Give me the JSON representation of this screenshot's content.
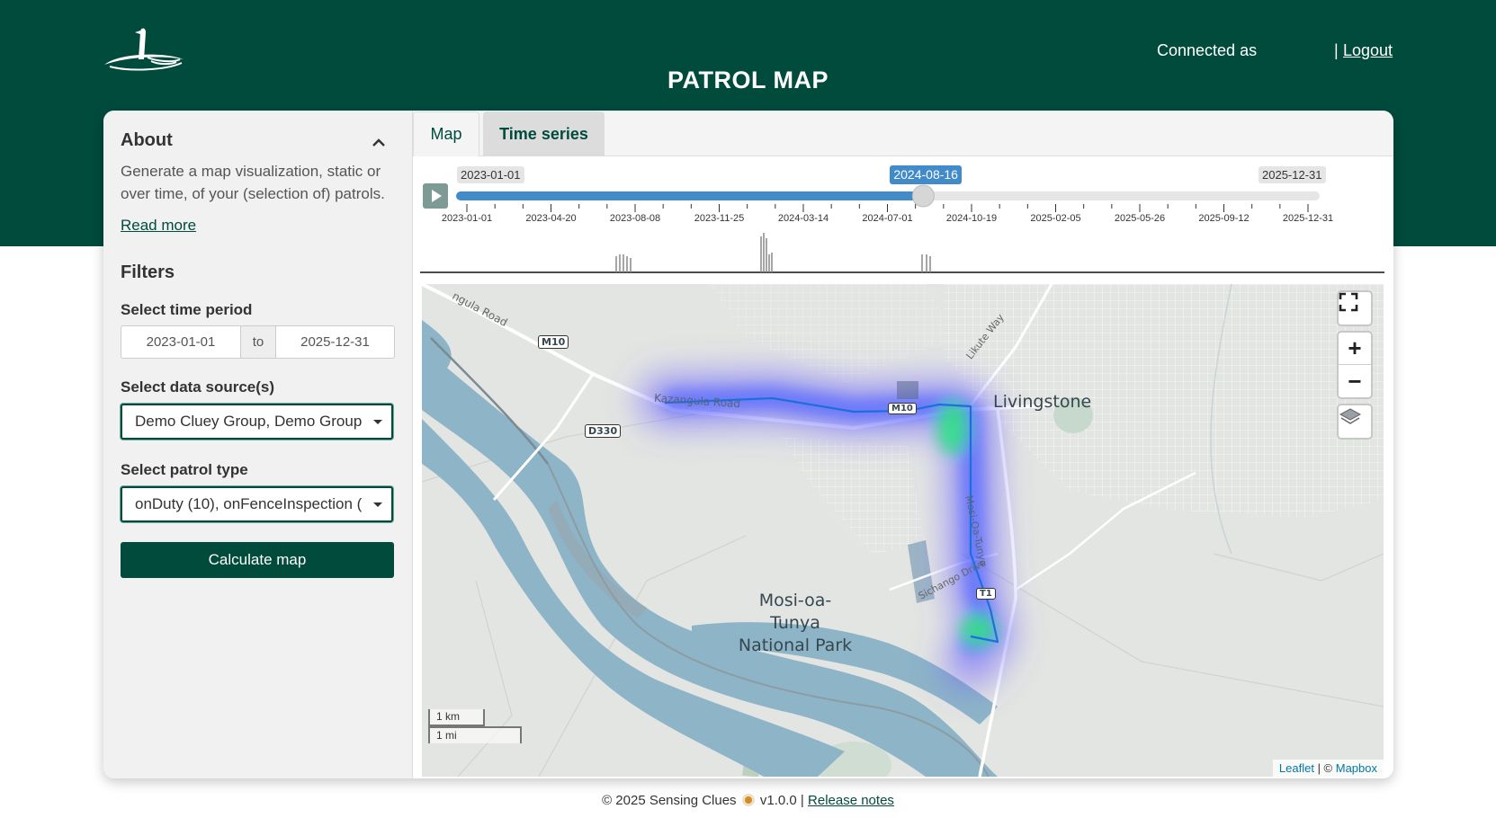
{
  "header": {
    "title": "PATROL MAP",
    "connected_label": "Connected as",
    "separator": "|",
    "logout": "Logout",
    "logo_icon": "meerkat-logo-icon",
    "band_color": "#014b3d"
  },
  "sidebar": {
    "about_title": "About",
    "about_text": "Generate a map visualization, static or over time, of your (selection of) patrols.",
    "read_more": "Read more",
    "filters_title": "Filters",
    "time_period_label": "Select time period",
    "date_from": "2023-01-01",
    "date_to_sep": "to",
    "date_to": "2025-12-31",
    "data_source_label": "Select data source(s)",
    "data_source_value": "Demo Cluey Group, Demo Group",
    "patrol_type_label": "Select patrol type",
    "patrol_type_value": "onDuty (10), onFenceInspection (",
    "calculate_button": "Calculate map"
  },
  "tabs": [
    {
      "label": "Map",
      "active": false
    },
    {
      "label": "Time series",
      "active": true
    }
  ],
  "slider": {
    "min_label": "2023-01-01",
    "max_label": "2025-12-31",
    "current_label": "2024-08-16",
    "current_fraction": 0.541,
    "ticks": [
      "2023-01-01",
      "2023-04-20",
      "2023-08-08",
      "2023-11-25",
      "2024-03-14",
      "2024-07-01",
      "2024-10-19",
      "2025-02-05",
      "2025-05-26",
      "2025-09-12",
      "2025-12-31"
    ]
  },
  "map": {
    "place_city": "Livingstone",
    "park_name_line1": "Mosi-oa-Tunya",
    "park_name_line2": "National Park",
    "road_kazangula": "Kazangula Road",
    "road_top": "ngula Road",
    "road_likute": "Likute Way",
    "road_sichango": "Sichango Drive",
    "road_mosi": "Mosi-Oa-Tunya",
    "shield_m10": "M10",
    "shield_d330": "D330",
    "shield_m10_b": "M10",
    "shield_t1": "T1",
    "scale_km": "1 km",
    "scale_mi": "1 mi",
    "attribution_leaflet": "Leaflet",
    "attribution_sep": " | © ",
    "attribution_mapbox": "Mapbox",
    "zoom_in": "+",
    "zoom_out": "−",
    "water_color": "#8db4c7",
    "track_color": "#1e6fdc"
  },
  "footer": {
    "copyright": "© 2025 Sensing Clues",
    "version": "v1.0.0 |",
    "release_notes": "Release notes"
  }
}
